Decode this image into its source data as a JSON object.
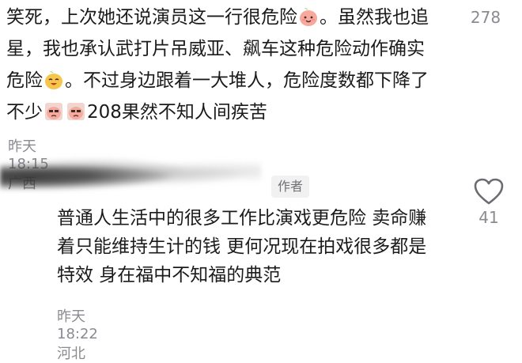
{
  "comment1": {
    "text_part1": "笑死，上次她还说演员这一行很危险",
    "text_part2": "。虽然我也追星，我也承认武打片吊威亚、飙车这种危险动作确实危险",
    "text_part3": "。不过身边跟着一大堆人，危险度数都下降了不少",
    "text_part4": "208果然不知人间疾苦",
    "time": "昨天 18:15",
    "location": "广西",
    "likes": "278",
    "emojis": [
      "peach-smile-icon",
      "peach-laugh-icon",
      "peach-sly-icon",
      "peach-sly-icon"
    ]
  },
  "comment2": {
    "badge": "作者",
    "text": "普通人生活中的很多工作比演戏更危险 卖命赚着只能维持生计的钱 更何况现在拍戏很多都是特效 身在福中不知福的典范",
    "time": "昨天 18:22",
    "location": "河北",
    "likes": "41"
  },
  "colors": {
    "text": "#1b1b1b",
    "meta": "#8a8b91",
    "badge_bg": "#f1f1f2",
    "emoji_pink": "#f6a99c",
    "emoji_yellow": "#f5c64a"
  }
}
